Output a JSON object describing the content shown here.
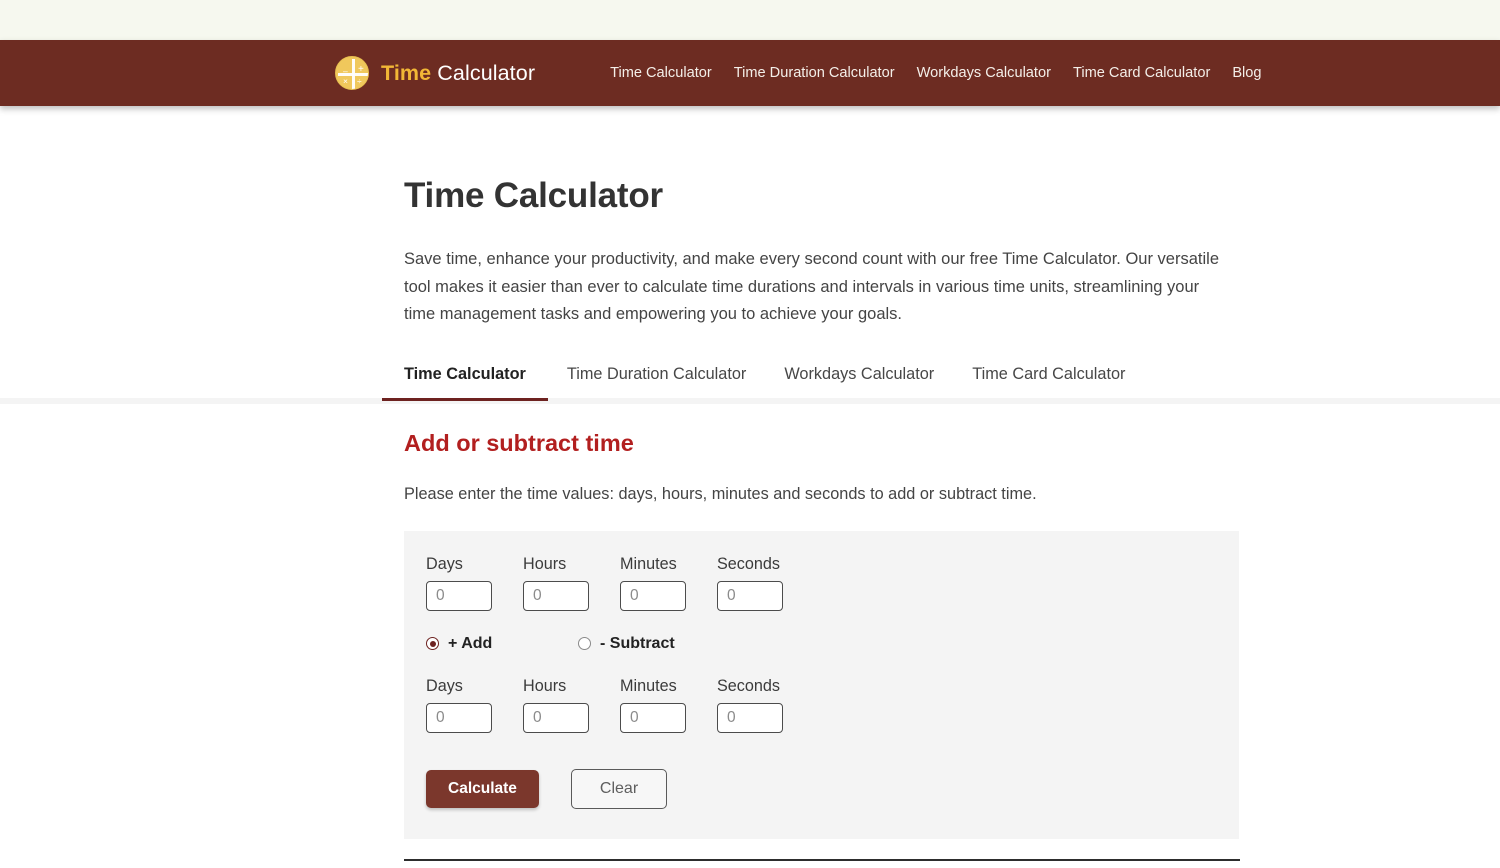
{
  "header": {
    "brand": {
      "word1": "Time",
      "word2": "Calculator",
      "logo_icon": "calculator-circle-icon",
      "ops": {
        "minus": "–",
        "plus": "+",
        "times": "×",
        "divide": "÷"
      }
    },
    "nav": [
      {
        "label": "Time Calculator"
      },
      {
        "label": "Time Duration Calculator"
      },
      {
        "label": "Workdays Calculator"
      },
      {
        "label": "Time Card Calculator"
      },
      {
        "label": "Blog"
      }
    ]
  },
  "page": {
    "title": "Time Calculator",
    "intro": "Save time, enhance your productivity, and make every second count with our free Time Calculator. Our versatile tool makes it easier than ever to calculate time durations and intervals in various time units, streamlining your time management tasks and empowering you to achieve your goals."
  },
  "tabs": [
    {
      "label": "Time Calculator",
      "active": true
    },
    {
      "label": "Time Duration Calculator",
      "active": false
    },
    {
      "label": "Workdays Calculator",
      "active": false
    },
    {
      "label": "Time Card Calculator",
      "active": false
    }
  ],
  "calculator": {
    "section_title": "Add or subtract time",
    "section_desc": "Please enter the time values: days, hours, minutes and seconds to add or subtract time.",
    "row1": [
      {
        "label": "Days",
        "value": "",
        "placeholder": "0"
      },
      {
        "label": "Hours",
        "value": "",
        "placeholder": "0"
      },
      {
        "label": "Minutes",
        "value": "",
        "placeholder": "0"
      },
      {
        "label": "Seconds",
        "value": "",
        "placeholder": "0"
      }
    ],
    "operation": [
      {
        "label": "+ Add",
        "selected": true
      },
      {
        "label": "- Subtract",
        "selected": false
      }
    ],
    "row2": [
      {
        "label": "Days",
        "value": "",
        "placeholder": "0"
      },
      {
        "label": "Hours",
        "value": "",
        "placeholder": "0"
      },
      {
        "label": "Minutes",
        "value": "",
        "placeholder": "0"
      },
      {
        "label": "Seconds",
        "value": "",
        "placeholder": "0"
      }
    ],
    "buttons": {
      "calculate": "Calculate",
      "clear": "Clear"
    }
  },
  "colors": {
    "header_bg": "#6d2c22",
    "brand_accent": "#f2b736",
    "section_title": "#b21f1f",
    "tab_active_underline": "#6d2220",
    "calculate_btn": "#7b372c",
    "panel_bg": "#f4f4f4",
    "top_strip": "#f6f8ef"
  }
}
